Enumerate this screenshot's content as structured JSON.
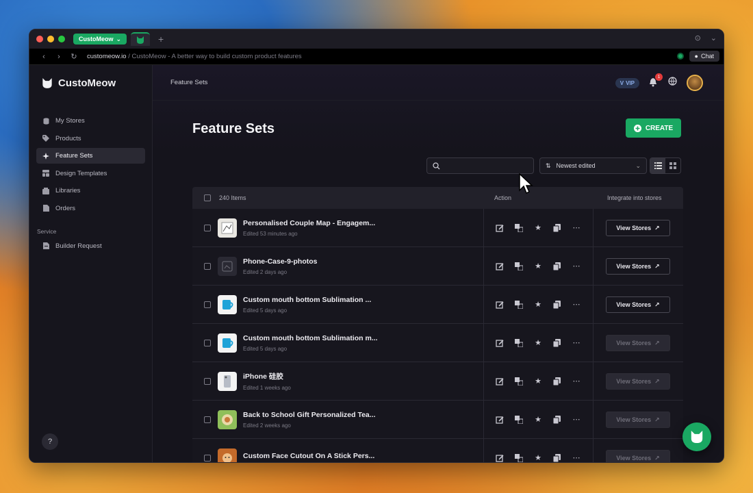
{
  "browser": {
    "tab_group": "CustoMeow",
    "url_host": "customeow.io",
    "url_rest": " / CustoMeow - A better way to build custom product features",
    "chat_label": "Chat"
  },
  "sidebar": {
    "logo": "CustoMeow",
    "items": [
      {
        "label": "My Stores",
        "icon": "database-icon"
      },
      {
        "label": "Products",
        "icon": "tag-icon"
      },
      {
        "label": "Feature Sets",
        "icon": "sparkle-icon",
        "active": true
      },
      {
        "label": "Design Templates",
        "icon": "layout-icon"
      },
      {
        "label": "Libraries",
        "icon": "library-icon"
      },
      {
        "label": "Orders",
        "icon": "document-icon"
      }
    ],
    "section": "Service",
    "service_items": [
      {
        "label": "Builder Request",
        "icon": "request-icon"
      }
    ],
    "help": "?"
  },
  "header": {
    "breadcrumb": "Feature Sets",
    "vip": "VIP",
    "notifications": "1"
  },
  "page": {
    "title": "Feature Sets",
    "create_label": "CREATE",
    "search_placeholder": "",
    "sort_label": "Newest edited"
  },
  "table": {
    "count_label": "240 Items",
    "action_header": "Action",
    "integrate_header": "Integrate into stores",
    "view_stores_label": "View Stores",
    "rows": [
      {
        "name": "Personalised Couple Map - Engagem...",
        "edited": "Edited 53 minutes ago",
        "enabled": true
      },
      {
        "name": "Phone-Case-9-photos",
        "edited": "Edited 2 days ago",
        "enabled": true
      },
      {
        "name": "Custom mouth bottom Sublimation ...",
        "edited": "Edited 5 days ago",
        "enabled": true
      },
      {
        "name": "Custom mouth bottom Sublimation m...",
        "edited": "Edited 5 days ago",
        "enabled": false
      },
      {
        "name": "iPhone 硅胶",
        "edited": "Edited 1 weeks ago",
        "enabled": false
      },
      {
        "name": "Back to School Gift Personalized Tea...",
        "edited": "Edited 2 weeks ago",
        "enabled": false
      },
      {
        "name": "Custom Face Cutout On A Stick Pers...",
        "edited": "",
        "enabled": false
      }
    ]
  },
  "colors": {
    "accent": "#1aa862",
    "background": "#15141c",
    "sidebar": "#16151d"
  }
}
